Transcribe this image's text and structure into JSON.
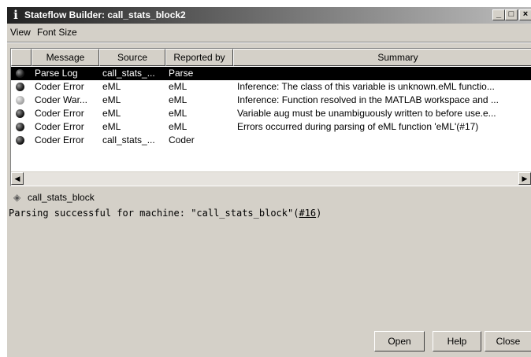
{
  "window": {
    "title": "Stateflow Builder: call_stats_block2",
    "icon": "info-icon"
  },
  "menu": {
    "items": [
      "View",
      "Font Size"
    ]
  },
  "table": {
    "columns": [
      "Message",
      "Source",
      "Reported by",
      "Summary"
    ],
    "rows": [
      {
        "status": "error",
        "message": "Parse Log",
        "source": "call_stats_...",
        "reported_by": "Parse",
        "summary": "",
        "selected": true
      },
      {
        "status": "error",
        "message": "Coder Error",
        "source": "eML",
        "reported_by": "eML",
        "summary": "Inference: The class of this variable is unknown.eML functio...",
        "selected": false
      },
      {
        "status": "warning",
        "message": "Coder War...",
        "source": "eML",
        "reported_by": "eML",
        "summary": "Inference: Function resolved in the MATLAB workspace and ...",
        "selected": false
      },
      {
        "status": "error",
        "message": "Coder Error",
        "source": "eML",
        "reported_by": "eML",
        "summary": "Variable aug must be unambiguously written to before use.e...",
        "selected": false
      },
      {
        "status": "error",
        "message": "Coder Error",
        "source": "eML",
        "reported_by": "eML",
        "summary": "Errors occurred during parsing of eML function 'eML'(#17)",
        "selected": false
      },
      {
        "status": "error",
        "message": "Coder Error",
        "source": "call_stats_...",
        "reported_by": "Coder",
        "summary": "",
        "selected": false
      }
    ]
  },
  "path_bar": {
    "text": "call_stats_block",
    "icon": "diamond-icon"
  },
  "console": {
    "prefix": "Parsing successful for machine: \"call_stats_block\"(",
    "link": "#16",
    "suffix": ")"
  },
  "buttons": {
    "open": "Open",
    "help": "Help",
    "close": "Close"
  },
  "colors": {
    "selection": "#000000",
    "dialog_bg": "#d4d0c8"
  }
}
